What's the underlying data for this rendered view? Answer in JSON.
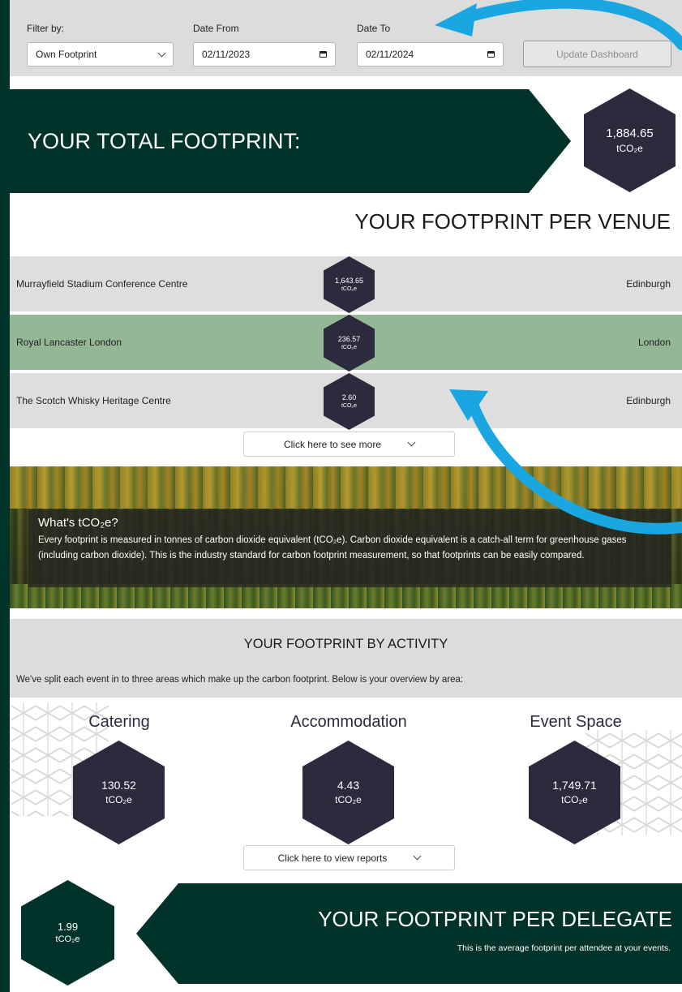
{
  "filters": {
    "filter_by_label": "Filter by:",
    "filter_by_value": "Own Footprint",
    "date_from_label": "Date From",
    "date_from_value": "02/11/2023",
    "date_to_label": "Date To",
    "date_to_value": "02/11/2024",
    "update_button": "Update Dashboard"
  },
  "total": {
    "title": "YOUR TOTAL FOOTPRINT:",
    "value": "1,884.65",
    "unit": "tCO₂e"
  },
  "venues": {
    "title": "YOUR FOOTPRINT PER VENUE",
    "rows": [
      {
        "name": "Murrayfield Stadium Conference Centre",
        "value": "1,643.65",
        "unit": "tCO₂e",
        "city": "Edinburgh"
      },
      {
        "name": "Royal Lancaster London",
        "value": "236.57",
        "unit": "tCO₂e",
        "city": "London"
      },
      {
        "name": "The Scotch Whisky Heritage Centre",
        "value": "2.60",
        "unit": "tCO₂e",
        "city": "Edinburgh"
      }
    ],
    "see_more": "Click here to see more"
  },
  "info": {
    "title": "What's tCO₂e?",
    "text": "Every footprint is measured in tonnes of carbon dioxide equivalent (tCO₂e). Carbon dioxide equivalent is a catch-all term for greenhouse gases (including carbon dioxide). This is the industry standard for carbon footprint measurement, so that footprints can be easily compared."
  },
  "activity": {
    "title": "YOUR FOOTPRINT BY ACTIVITY",
    "description": "We've split each event in to three areas which make up the carbon footprint. Below is your overview by area:",
    "categories": [
      {
        "label": "Catering",
        "value": "130.52",
        "unit": "tCO₂e"
      },
      {
        "label": "Accommodation",
        "value": "4.43",
        "unit": "tCO₂e"
      },
      {
        "label": "Event Space",
        "value": "1,749.71",
        "unit": "tCO₂e"
      }
    ],
    "view_reports": "Click here to view reports"
  },
  "delegate": {
    "title": "YOUR FOOTPRINT PER DELEGATE",
    "subtitle": "This is the average footprint per attendee at your events.",
    "value": "1.99",
    "unit": "tCO₂e"
  },
  "colors": {
    "dark_green": "#02332a",
    "hex_dark": "#2d2a3e",
    "row_highlight": "#94b896",
    "panel_grey": "#dcdcdc",
    "arrow_blue": "#1aa6e0"
  }
}
